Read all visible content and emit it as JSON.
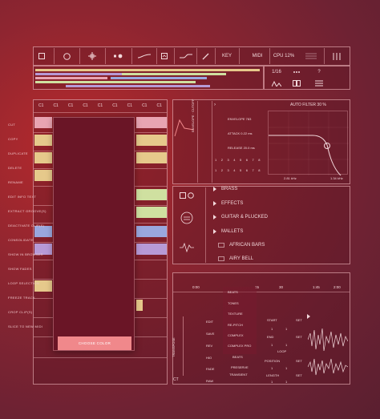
{
  "toolbar": {
    "key_label": "KEY",
    "midi_label": "MIDI",
    "cpu_label": "CPU 12%"
  },
  "transport": {
    "quantize": "1/16",
    "help": "?"
  },
  "timeline": {
    "bars": [
      "C1",
      "C1",
      "C1",
      "C1",
      "C1",
      "C1",
      "C1",
      "C1",
      "C1"
    ]
  },
  "menu": {
    "items": [
      "CUT",
      "COPY",
      "DUPLICATE",
      "DELETE",
      "RENAME",
      "EDIT INFO TEXT",
      "EXTRACT GROOVE(S)",
      "DEACTIVATE CLIP(S)",
      "CONSOLIDATE",
      "SHOW IN BROWSER",
      "SHOW FADES",
      "LOOP SELECTION",
      "FREEZE TRACK",
      "CROP CLIP(S)",
      "SLICE TO NEW MIDI"
    ],
    "choose_label": "CHOOSE COLOR"
  },
  "synth": {
    "auto_filter": "AUTO FILTER 30 %",
    "env_labels": [
      "ENVELOPE 783",
      "ATTACK 0.22 ms",
      "RELEASE 20.0 ms"
    ],
    "side_label": "ENVELOPE",
    "side_sub": "CUTOFF",
    "freq_a": "2.81 kHz",
    "freq_b": "1.34 kHz",
    "knob_numbers": [
      "1",
      "2",
      "3",
      "4",
      "5",
      "6",
      "7",
      "8",
      "1",
      "2",
      "3",
      "4",
      "5",
      "6",
      "7",
      "8"
    ]
  },
  "browser": {
    "items": [
      "BRASS",
      "EFFECTS",
      "GUITAR & PLUCKED",
      "MALLETS",
      "AFRICAN BARS",
      "AIRY BELL"
    ]
  },
  "sampler": {
    "ruler": [
      "0:00",
      "15",
      "30",
      "1:45",
      "2:00"
    ],
    "left_labels": [
      "EDIT",
      "SAVE",
      "REV",
      "HIO",
      "FADE",
      "RAW"
    ],
    "mode_labels": [
      "BEATS",
      "TONES",
      "TEXTURE",
      "RE-PITCH",
      "COMPLEX",
      "COMPLEX PRO"
    ],
    "mid_labels": [
      "BEATS",
      "PRESERVE",
      "TRANSIENT"
    ],
    "right_labels": [
      "START",
      "SET",
      "END",
      "SET",
      "LOOP",
      "POSITION",
      "SET",
      "LENGTH",
      "SET"
    ],
    "small_nums": [
      "1",
      "1",
      "1",
      "1",
      "1",
      "1",
      "1",
      "1"
    ],
    "vert_label": "TRANSPOSE",
    "ct": "CT"
  },
  "colors": {
    "accent": "#f0888b",
    "clip_pink": "#e8a4b2",
    "clip_yellow": "#e6c98b",
    "clip_green": "#cfe0a0",
    "clip_blue": "#9aa7de",
    "clip_purple": "#b79ad6"
  }
}
